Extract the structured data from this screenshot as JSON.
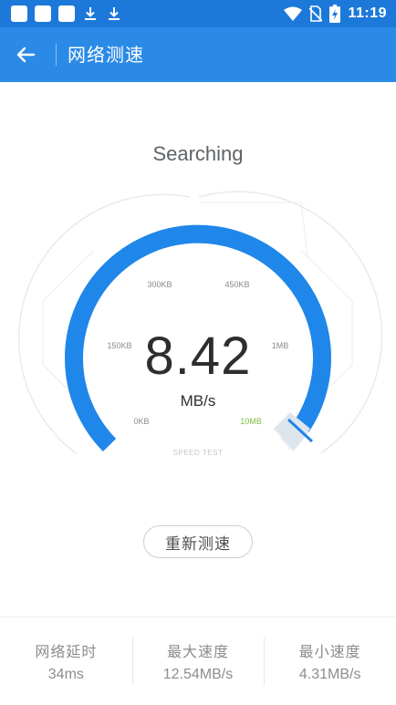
{
  "status_bar": {
    "time": "11:19",
    "icons": [
      "notification-square-icon",
      "notification-square-icon",
      "notification-square-icon",
      "download-icon",
      "download-icon",
      "wifi-icon",
      "no-sim-icon",
      "battery-charging-icon"
    ],
    "background": "#1d79d9"
  },
  "app_bar": {
    "title": "网络测速",
    "back_icon": "arrow-left-icon",
    "background": "#2b8ae6"
  },
  "test": {
    "status": "Searching",
    "speed_value": "8.42",
    "speed_unit": "MB/s",
    "caption": "SPEED TEST",
    "gauge_fill_fraction": 0.96,
    "accent": "#1f86ea",
    "max_label_color": "#7bbf3b"
  },
  "gauge_labels": [
    {
      "text": "0KB"
    },
    {
      "text": "150KB"
    },
    {
      "text": "300KB"
    },
    {
      "text": "450KB"
    },
    {
      "text": "1MB"
    },
    {
      "text": "10MB"
    }
  ],
  "actions": {
    "retest_label": "重新测速"
  },
  "stats": [
    {
      "label": "网络延时",
      "value": "34ms"
    },
    {
      "label": "最大速度",
      "value": "12.54MB/s"
    },
    {
      "label": "最小速度",
      "value": "4.31MB/s"
    }
  ]
}
